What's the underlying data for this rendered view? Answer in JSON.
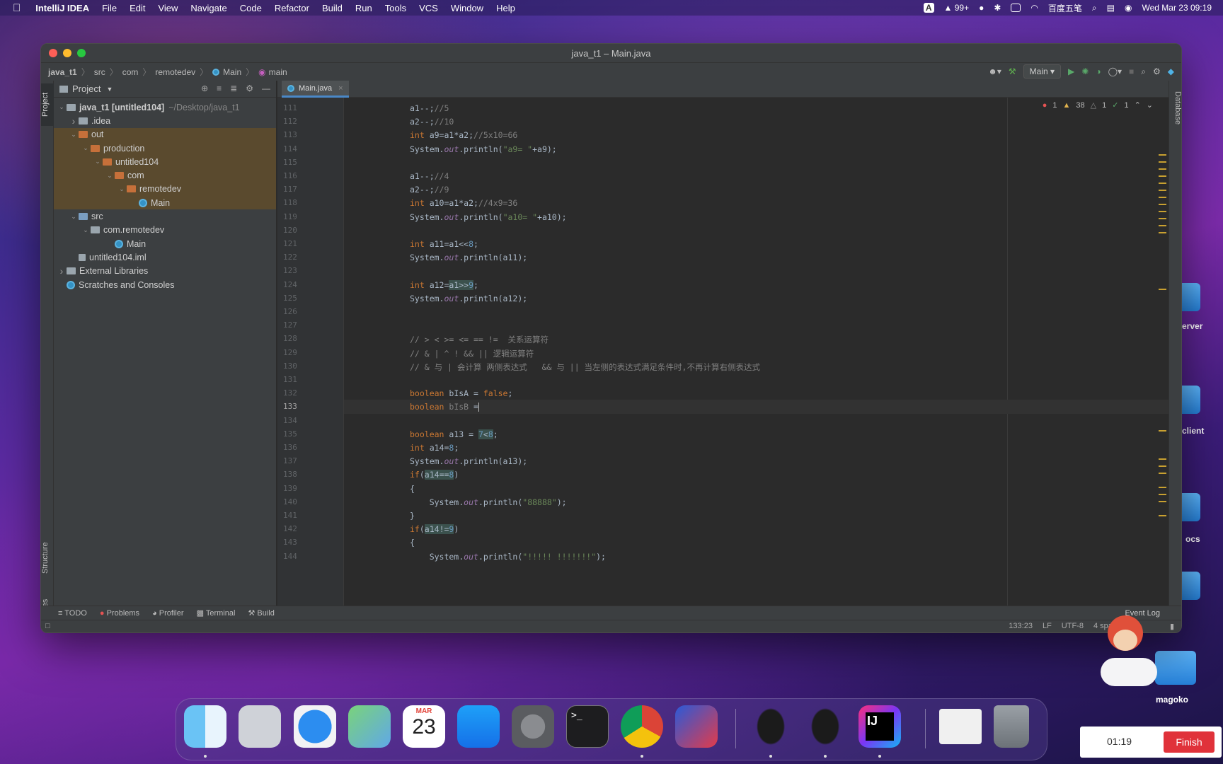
{
  "menubar": {
    "app": "IntelliJ IDEA",
    "items": [
      "File",
      "Edit",
      "View",
      "Navigate",
      "Code",
      "Refactor",
      "Build",
      "Run",
      "Tools",
      "VCS",
      "Window",
      "Help"
    ],
    "notif": "99+",
    "ime": "百度五笔",
    "datetime": "Wed Mar 23  09:19"
  },
  "window": {
    "title": "java_t1 – Main.java"
  },
  "breadcrumb": [
    "java_t1",
    "src",
    "com",
    "remotedev",
    "Main",
    "main"
  ],
  "runconfig": "Main",
  "project": {
    "header": "Project",
    "tree": [
      {
        "label": "java_t1 [untitled104]",
        "extra": "~/Desktop/java_t1",
        "depth": 0,
        "arrow": "open",
        "icon": "plain",
        "bold": true
      },
      {
        "label": ".idea",
        "depth": 1,
        "arrow": "closed",
        "icon": "plain"
      },
      {
        "label": "out",
        "depth": 1,
        "arrow": "open",
        "icon": "orange",
        "hl": true
      },
      {
        "label": "production",
        "depth": 2,
        "arrow": "open",
        "icon": "orange",
        "hl": true
      },
      {
        "label": "untitled104",
        "depth": 3,
        "arrow": "open",
        "icon": "orange",
        "hl": true
      },
      {
        "label": "com",
        "depth": 4,
        "arrow": "open",
        "icon": "orange",
        "hl": true
      },
      {
        "label": "remotedev",
        "depth": 5,
        "arrow": "open",
        "icon": "orange",
        "hl": true
      },
      {
        "label": "Main",
        "depth": 6,
        "arrow": "none",
        "icon": "class",
        "hl": true
      },
      {
        "label": "src",
        "depth": 1,
        "arrow": "open",
        "icon": "blue"
      },
      {
        "label": "com.remotedev",
        "depth": 2,
        "arrow": "open",
        "icon": "plain"
      },
      {
        "label": "Main",
        "depth": 4,
        "arrow": "none",
        "icon": "class"
      },
      {
        "label": "untitled104.iml",
        "depth": 1,
        "arrow": "none",
        "icon": "file"
      },
      {
        "label": "External Libraries",
        "depth": 0,
        "arrow": "closed",
        "icon": "lib"
      },
      {
        "label": "Scratches and Consoles",
        "depth": 0,
        "arrow": "none",
        "icon": "scratch"
      }
    ]
  },
  "leftTabs": {
    "project": "Project",
    "structure": "Structure",
    "favorites": "Favorites"
  },
  "rightTabs": {
    "database": "Database"
  },
  "editor": {
    "tab": "Main.java",
    "inspections": {
      "errors": "1",
      "warnings": "38",
      "weak": "1",
      "ok": "1"
    },
    "lines": [
      {
        "n": "111",
        "html": "<span>a1</span>--;<span class='cm'>//5</span>"
      },
      {
        "n": "112",
        "html": "a2--;<span class='cm'>//10</span>"
      },
      {
        "n": "113",
        "html": "<span class='kw'>int</span> a9=a1*a2;<span class='cm'>//5x10=66</span>"
      },
      {
        "n": "114",
        "html": "System.<span class='it'>out</span>.println(<span class='st'>\"a9= \"</span>+a9);"
      },
      {
        "n": "115",
        "html": ""
      },
      {
        "n": "116",
        "html": "a1--;<span class='cm'>//4</span>"
      },
      {
        "n": "117",
        "html": "a2--;<span class='cm'>//9</span>"
      },
      {
        "n": "118",
        "html": "<span class='kw'>int</span> a10=a1*a2;<span class='cm'>//4x9=36</span>"
      },
      {
        "n": "119",
        "html": "System.<span class='it'>out</span>.println(<span class='st'>\"a10= \"</span>+a10);"
      },
      {
        "n": "120",
        "html": ""
      },
      {
        "n": "121",
        "html": "<span class='kw'>int</span> a11=a1&lt;&lt;<span class='nm'>8</span>;"
      },
      {
        "n": "122",
        "html": "System.<span class='it'>out</span>.println(a11);"
      },
      {
        "n": "123",
        "html": ""
      },
      {
        "n": "124",
        "html": "<span class='kw'>int</span> a12=<span class='hlv'>a1&gt;&gt;<span class='nm'>9</span></span>;"
      },
      {
        "n": "125",
        "html": "System.<span class='it'>out</span>.println(a12);"
      },
      {
        "n": "126",
        "html": ""
      },
      {
        "n": "127",
        "html": ""
      },
      {
        "n": "128",
        "html": "<span class='cm'>// &gt; &lt; &gt;= &lt;= == !=  关系运算符</span>"
      },
      {
        "n": "129",
        "html": "<span class='cm'>// &amp; | ^ ! &amp;&amp; || 逻辑运算符</span>"
      },
      {
        "n": "130",
        "html": "<span class='cm'>// &amp; 与 | 会计算 两侧表达式   &amp;&amp; 与 || 当左侧的表达式满足条件时,不再计算右侧表达式</span>"
      },
      {
        "n": "131",
        "html": ""
      },
      {
        "n": "132",
        "html": "<span class='kw'>boolean</span> bIsA = <span class='kw'>false</span>;"
      },
      {
        "n": "133",
        "html": "<span class='kw'>boolean</span> <span class='cm'>bIsB</span> =<span class='caret'></span>",
        "cur": true
      },
      {
        "n": "134",
        "html": ""
      },
      {
        "n": "135",
        "html": "<span class='kw'>boolean</span> a13 = <span class='hlv'><span class='nm'>7</span>&lt;<span class='nm'>8</span></span>;"
      },
      {
        "n": "136",
        "html": "<span class='kw'>int</span> a14=<span class='nm'>8</span>;"
      },
      {
        "n": "137",
        "html": "System.<span class='it'>out</span>.println(a13);"
      },
      {
        "n": "138",
        "html": "<span class='kw'>if</span>(<span class='hlv'>a14==<span class='nm'>8</span></span>)"
      },
      {
        "n": "139",
        "html": "{"
      },
      {
        "n": "140",
        "html": "    System.<span class='it'>out</span>.println(<span class='st'>\"88888\"</span>);"
      },
      {
        "n": "141",
        "html": "}"
      },
      {
        "n": "142",
        "html": "<span class='kw'>if</span>(<span class='hlv'>a14!=<span class='nm'>9</span></span>)"
      },
      {
        "n": "143",
        "html": "{"
      },
      {
        "n": "144",
        "html": "    System.<span class='it'>out</span>.println(<span class='st'>\"!!!!! !!!!!!!\"</span>);"
      }
    ]
  },
  "bottomTools": [
    "TODO",
    "Problems",
    "Profiler",
    "Terminal",
    "Build"
  ],
  "eventLog": "Event Log",
  "status": {
    "pos": "133:23",
    "lf": "LF",
    "enc": "UTF-8",
    "spaces": "4 spaces"
  },
  "desktop": {
    "labels": [
      "erver",
      "client",
      "ocs",
      "magoko"
    ],
    "dockDate": {
      "month": "MAR",
      "day": "23"
    }
  },
  "recorder": {
    "time": "01:19",
    "finish": "Finish"
  }
}
